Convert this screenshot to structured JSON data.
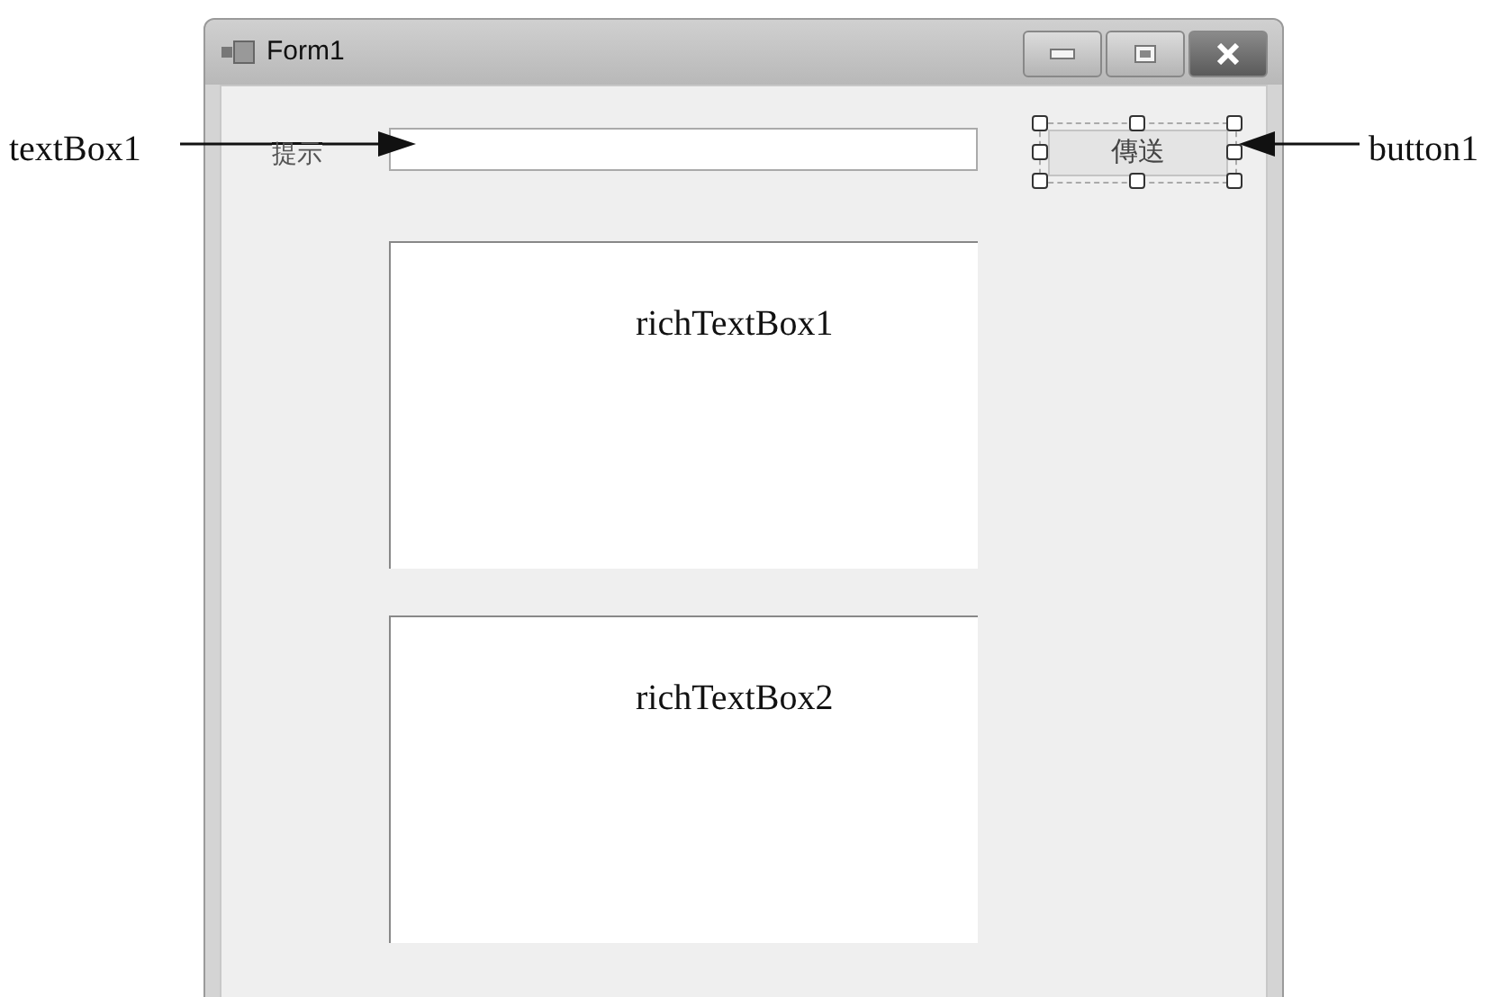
{
  "window": {
    "title": "Form1"
  },
  "form": {
    "label": "提示",
    "button": {
      "label": "傳送",
      "selected": true
    },
    "rich_text_boxes": [
      {
        "text": "richTextBox1"
      },
      {
        "text": "richTextBox2"
      }
    ]
  },
  "annotations": [
    {
      "label": "textBox1",
      "kind": "left"
    },
    {
      "label": "button1",
      "kind": "right"
    }
  ]
}
